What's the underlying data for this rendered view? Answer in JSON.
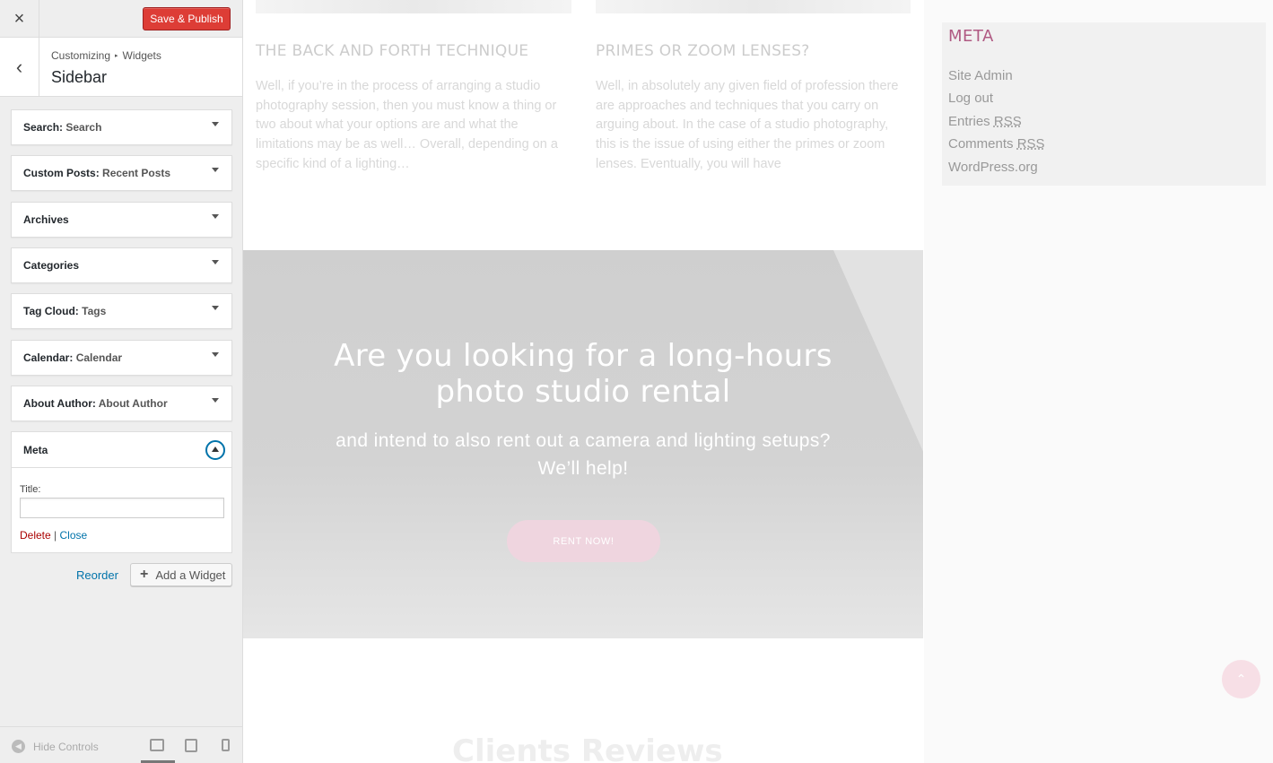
{
  "customizer": {
    "close_icon": "×",
    "save_label": "Save & Publish",
    "back_icon": "‹",
    "breadcrumb": {
      "root": "Customizing",
      "separator": "▸",
      "current": "Widgets"
    },
    "section_title": "Sidebar",
    "widgets": [
      {
        "name": "Search",
        "sep": ": ",
        "instance": "Search"
      },
      {
        "name": "Custom Posts",
        "sep": ": ",
        "instance": "Recent Posts"
      },
      {
        "name": "Archives",
        "sep": "",
        "instance": ""
      },
      {
        "name": "Categories",
        "sep": "",
        "instance": ""
      },
      {
        "name": "Tag Cloud",
        "sep": ": ",
        "instance": "Tags"
      },
      {
        "name": "Calendar",
        "sep": ": ",
        "instance": "Calendar"
      },
      {
        "name": "About Author",
        "sep": ": ",
        "instance": "About Author"
      }
    ],
    "meta_widget": {
      "title": "Meta",
      "field_label": "Title:",
      "field_value": "",
      "delete_label": "Delete",
      "action_separator": " | ",
      "close_label": "Close"
    },
    "reorder_label": "Reorder",
    "add_widget_icon": "+",
    "add_widget_label": "Add a Widget",
    "footer": {
      "hide_controls_icon": "◀",
      "hide_controls_label": "Hide Controls"
    },
    "colors": {
      "save_bg": "#dd3d36",
      "link": "#0073aa",
      "delete": "#aa0000"
    }
  },
  "preview": {
    "posts": [
      {
        "title": "THE BACK AND FORTH TECHNIQUE",
        "excerpt": "Well, if you’re in the process of arranging a studio photography session, then you must know a thing or two about what your options are and what the limitations may be as well… Overall, depending on a specific kind of a lighting…"
      },
      {
        "title": "PRIMES OR ZOOM LENSES?",
        "excerpt": "Well, in absolutely any given field of profession there are approaches and techniques that you carry on arguing about. In the case of a studio photography, this is the issue of using either the primes or zoom lenses. Eventually, you will have"
      }
    ],
    "banner": {
      "heading_line1": "Are you looking for a long-hours",
      "heading_line2": "photo studio rental",
      "sub_line1": "and intend to also rent out a camera and lighting setups?",
      "sub_line2": "We’ll help!",
      "button": "RENT NOW!"
    },
    "clients_heading": "Clients Reviews",
    "meta_sidebar": {
      "title": "META",
      "links": [
        "Site Admin",
        "Log out",
        "Entries",
        "Comments",
        "WordPress.org"
      ],
      "rss": "RSS"
    },
    "to_top_icon": "⌃",
    "colors": {
      "meta_title": "#b05a83",
      "button_bg": "#efd5df"
    }
  }
}
